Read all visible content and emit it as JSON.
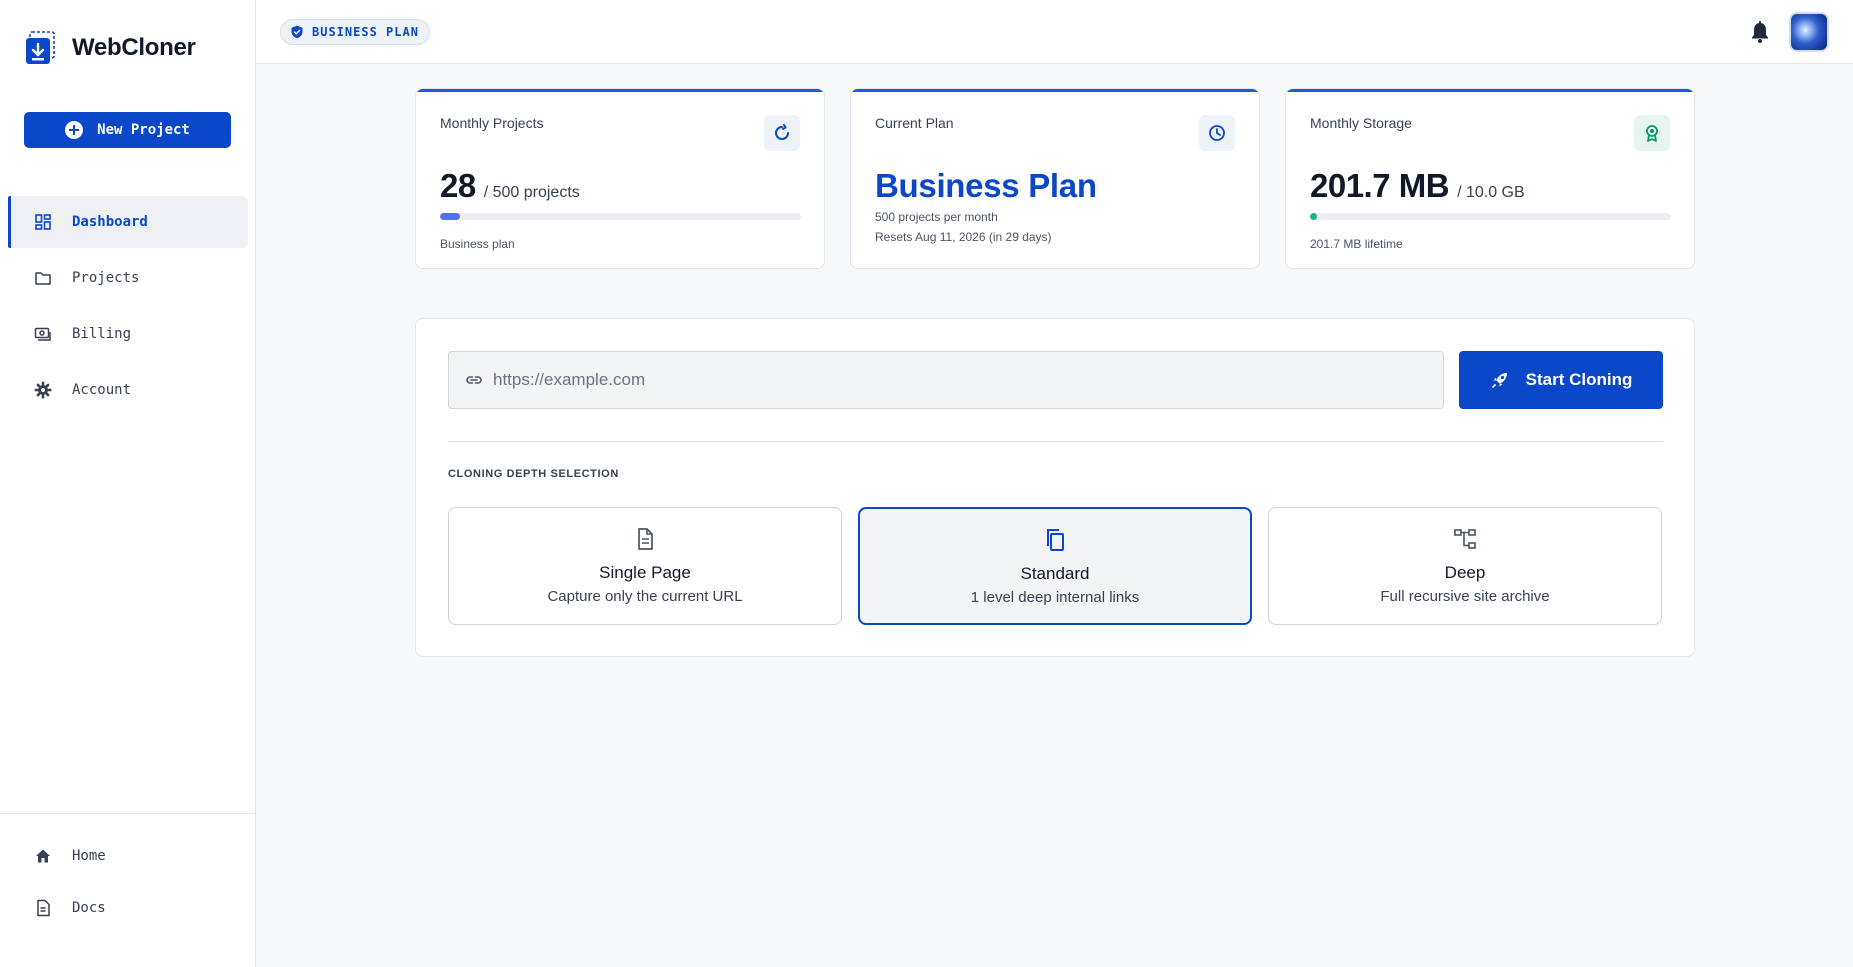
{
  "app": {
    "name": "WebCloner"
  },
  "sidebar": {
    "new_project_label": "New Project",
    "items": [
      {
        "label": "Dashboard",
        "icon": "grid-icon",
        "active": true
      },
      {
        "label": "Projects",
        "icon": "folder-icon"
      },
      {
        "label": "Billing",
        "icon": "billing-icon"
      },
      {
        "label": "Account",
        "icon": "gear-icon"
      }
    ],
    "bottom_items": [
      {
        "label": "Home",
        "icon": "home-icon"
      },
      {
        "label": "Docs",
        "icon": "document-icon"
      }
    ]
  },
  "header": {
    "plan_badge": "BUSINESS PLAN"
  },
  "cards": {
    "projects": {
      "title": "Monthly Projects",
      "value": "28",
      "total": "/ 500 projects",
      "progress": 0.056,
      "note": "Business plan",
      "icon": "refresh-icon"
    },
    "plan": {
      "title": "Current Plan",
      "name": "Business Plan",
      "detail": "500 projects per month",
      "reset": "Resets Aug 11, 2026 (in 29 days)",
      "icon": "clock-icon"
    },
    "storage": {
      "title": "Monthly Storage",
      "value": "201.7 MB",
      "total": "/ 10.0 GB",
      "progress": 0.02,
      "note": "201.7 MB lifetime",
      "icon": "award-icon"
    }
  },
  "clone": {
    "url_placeholder": "https://example.com",
    "start_label": "Start Cloning",
    "depth_heading": "CLONING DEPTH SELECTION",
    "options": [
      {
        "title": "Single Page",
        "desc": "Capture only the current URL",
        "selected": false
      },
      {
        "title": "Standard",
        "desc": "1 level deep internal links",
        "selected": true
      },
      {
        "title": "Deep",
        "desc": "Full recursive site archive",
        "selected": false
      }
    ]
  },
  "colors": {
    "accent": "#0a47c9",
    "progress_blue": "#4f72e8",
    "progress_green": "#10b981"
  }
}
